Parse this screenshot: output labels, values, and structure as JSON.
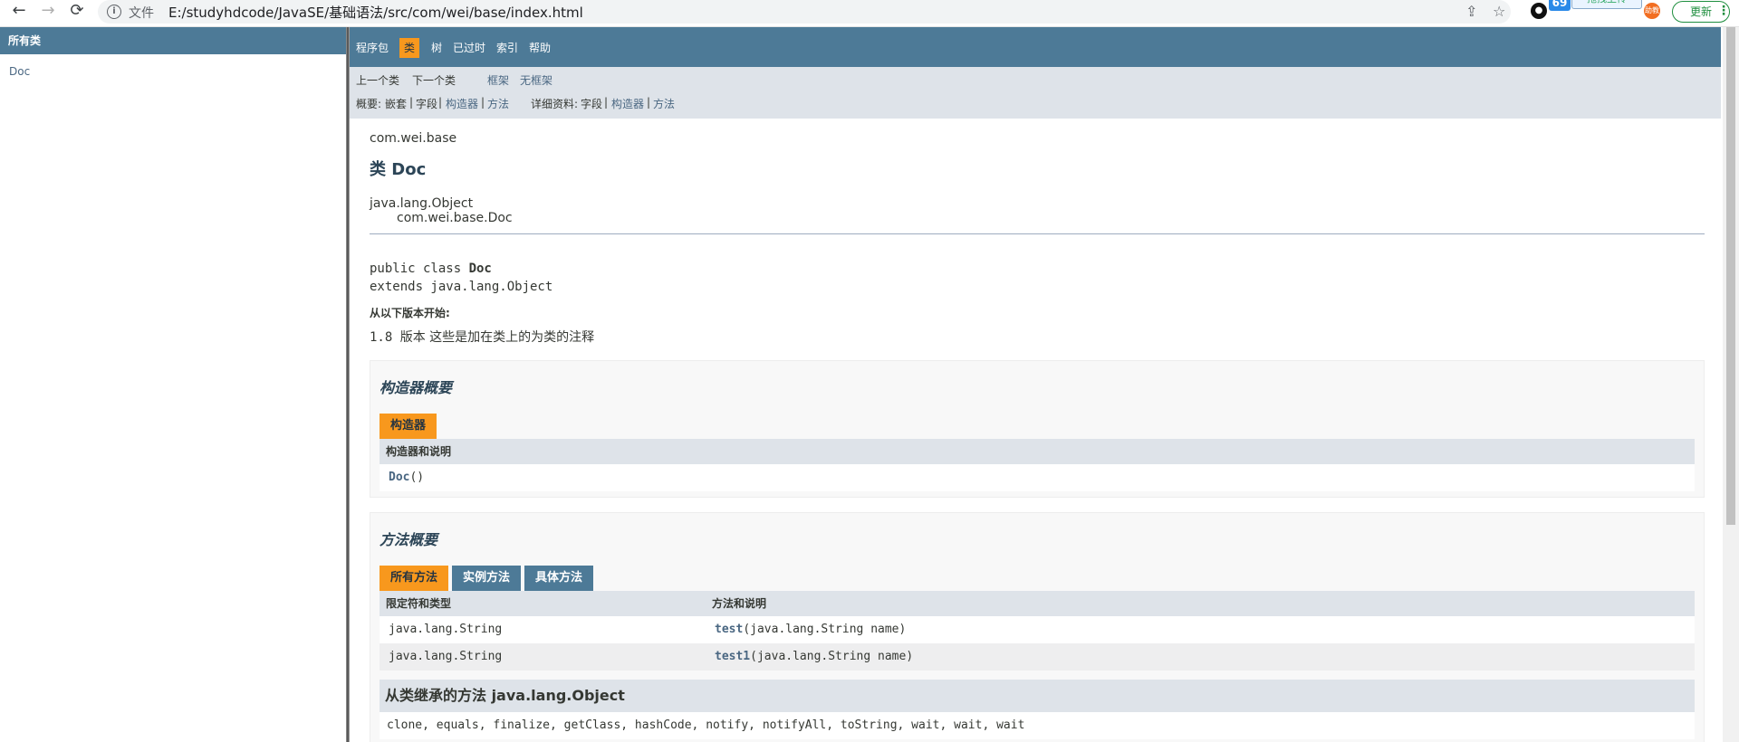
{
  "browser": {
    "back_icon": "←",
    "forward_icon": "→",
    "reload_icon": "⟳",
    "scheme_label": "文件",
    "url": "E:/studyhdcode/JavaSE/基础语法/src/com/wei/base/index.html",
    "share_icon": "⇪",
    "star_icon": "☆",
    "update_label": "更新",
    "kebab": "⋮",
    "upload_tip": "拖拽上传",
    "bd_logo": "69",
    "ext_label": "助教"
  },
  "left": {
    "header": "所有类",
    "items": [
      {
        "label": "Doc"
      }
    ]
  },
  "topnav": {
    "items": [
      "程序包",
      "类",
      "树",
      "已过时",
      "索引",
      "帮助"
    ],
    "active": "类"
  },
  "subnav": {
    "prev_class": "上一个类",
    "next_class": "下一个类",
    "frames": "框架",
    "no_frames": "无框架",
    "summary_prefix": "概要:",
    "summary_nested": "嵌套",
    "summary_field": "字段",
    "summary_constructor": "构造器",
    "summary_method": "方法",
    "detail_prefix": "详细资料:",
    "detail_field": "字段",
    "detail_constructor": "构造器",
    "detail_method": "方法",
    "sep": "|"
  },
  "class_info": {
    "package": "com.wei.base",
    "title": "类 Doc",
    "parent": "java.lang.Object",
    "child": "com.wei.base.Doc",
    "decl_1": "public class ",
    "decl_name": "Doc",
    "decl_2": "extends java.lang.Object",
    "since_label": "从以下版本开始:",
    "since_version": "1.8 版本",
    "since_text": " 这些是加在类上的为类的注释"
  },
  "constructor_summary": {
    "heading": "构造器概要",
    "tab": "构造器",
    "col_header": "构造器和说明",
    "rows": [
      {
        "name": "Doc",
        "params": "()"
      }
    ]
  },
  "method_summary": {
    "heading": "方法概要",
    "tabs": [
      "所有方法",
      "实例方法",
      "具体方法"
    ],
    "col1": "限定符和类型",
    "col2": "方法和说明",
    "rows": [
      {
        "type": "java.lang.String",
        "name": "test",
        "params": "(java.lang.String name)"
      },
      {
        "type": "java.lang.String",
        "name": "test1",
        "params": "(java.lang.String name)"
      }
    ],
    "inherited_heading": "从类继承的方法 java.lang.Object",
    "inherited_list": "clone, equals, finalize, getClass, hashCode, notify, notifyAll, toString, wait, wait, wait"
  }
}
